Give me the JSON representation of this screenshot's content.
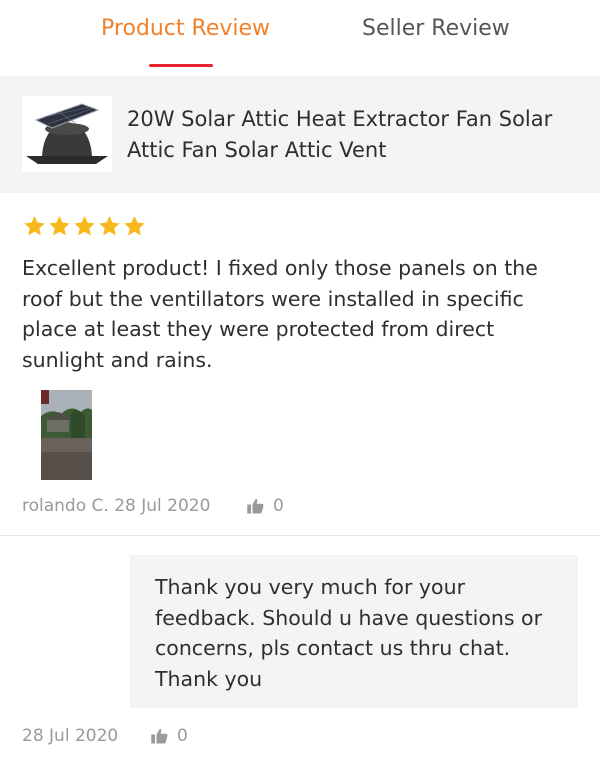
{
  "tabs": {
    "product_review": "Product Review",
    "seller_review": "Seller Review"
  },
  "product": {
    "title": "20W Solar Attic Heat Extractor Fan Solar Attic Fan Solar Attic Vent"
  },
  "review": {
    "rating": 5,
    "max_rating": 5,
    "text": "Excellent product! I fixed only those panels on the roof but the ventillators were installed in specific place at least they were protected from direct sunlight and rains.",
    "author_date": "rolando C. 28 Jul 2020",
    "likes": "0"
  },
  "seller_reply": {
    "text": "Thank you very much for your feedback. Should u have questions or concerns, pls contact us thru chat. Thank you",
    "date": "28 Jul 2020",
    "likes": "0"
  },
  "colors": {
    "active_tab": "#f2802a",
    "tab_indicator": "#e5242b",
    "star": "#f7b81b",
    "muted_text": "#9a9a9a",
    "card_bg": "#f4f4f6"
  },
  "icons": {
    "star": "star-icon",
    "like": "thumbs-up-icon"
  }
}
